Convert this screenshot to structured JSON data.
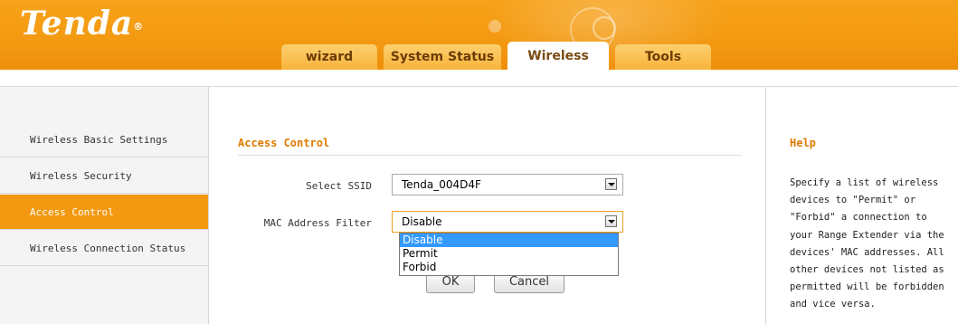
{
  "brand": {
    "logo_text": "Tenda",
    "logo_mark": "®"
  },
  "tabs": [
    {
      "label": "wizard"
    },
    {
      "label": "System Status"
    },
    {
      "label": "Wireless",
      "active": true
    },
    {
      "label": "Tools"
    }
  ],
  "sidebar": {
    "items": [
      {
        "label": "Wireless Basic Settings"
      },
      {
        "label": "Wireless Security"
      },
      {
        "label": "Access Control",
        "active": true
      },
      {
        "label": "Wireless Connection Status"
      }
    ]
  },
  "main": {
    "title": "Access Control",
    "ssid": {
      "label": "Select SSID",
      "value": "Tenda_004D4F"
    },
    "mac_filter": {
      "label": "MAC Address Filter",
      "value": "Disable",
      "options": [
        "Disable",
        "Permit",
        "Forbid"
      ]
    },
    "ok_label": "OK",
    "cancel_label": "Cancel"
  },
  "help": {
    "title": "Help",
    "text": "Specify a list of wireless\ndevices to \"Permit\" or\n\"Forbid\" a connection to\nyour Range Extender via the\ndevices' MAC addresses. All\nother devices not listed as\npermitted will be forbidden\nand vice versa."
  },
  "colors": {
    "accent": "#f39811",
    "header": "#f39a12",
    "title": "#e07a00",
    "option_highlight": "#3399ff"
  }
}
